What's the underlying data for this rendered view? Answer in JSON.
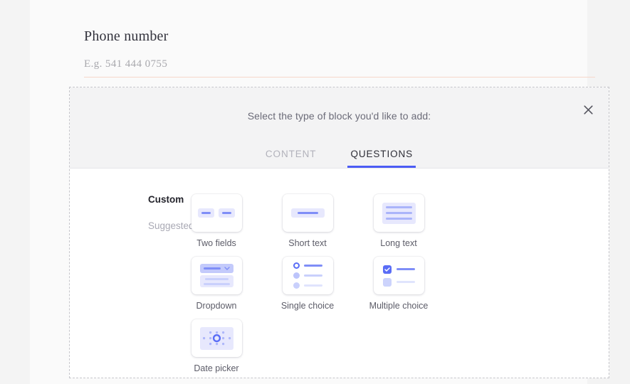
{
  "form": {
    "field_label": "Phone number",
    "field_placeholder": "E.g. 541 444 0755",
    "underline_color": "#f6d7cb"
  },
  "block_picker": {
    "prompt": "Select the type of block you'd like to add:",
    "close_icon": "close-icon",
    "accent_color": "#4c5cf5",
    "tabs": [
      {
        "label": "CONTENT",
        "active": false
      },
      {
        "label": "QUESTIONS",
        "active": true
      }
    ],
    "categories": [
      {
        "label": "Custom",
        "selected": true
      },
      {
        "label": "Suggested",
        "selected": false
      }
    ],
    "blocks": [
      {
        "label": "Two fields",
        "icon": "two-fields-icon"
      },
      {
        "label": "Short text",
        "icon": "short-text-icon"
      },
      {
        "label": "Long text",
        "icon": "long-text-icon"
      },
      {
        "label": "Dropdown",
        "icon": "dropdown-icon"
      },
      {
        "label": "Single choice",
        "icon": "single-choice-icon"
      },
      {
        "label": "Multiple choice",
        "icon": "multiple-choice-icon"
      },
      {
        "label": "Date picker",
        "icon": "date-picker-icon"
      }
    ]
  }
}
